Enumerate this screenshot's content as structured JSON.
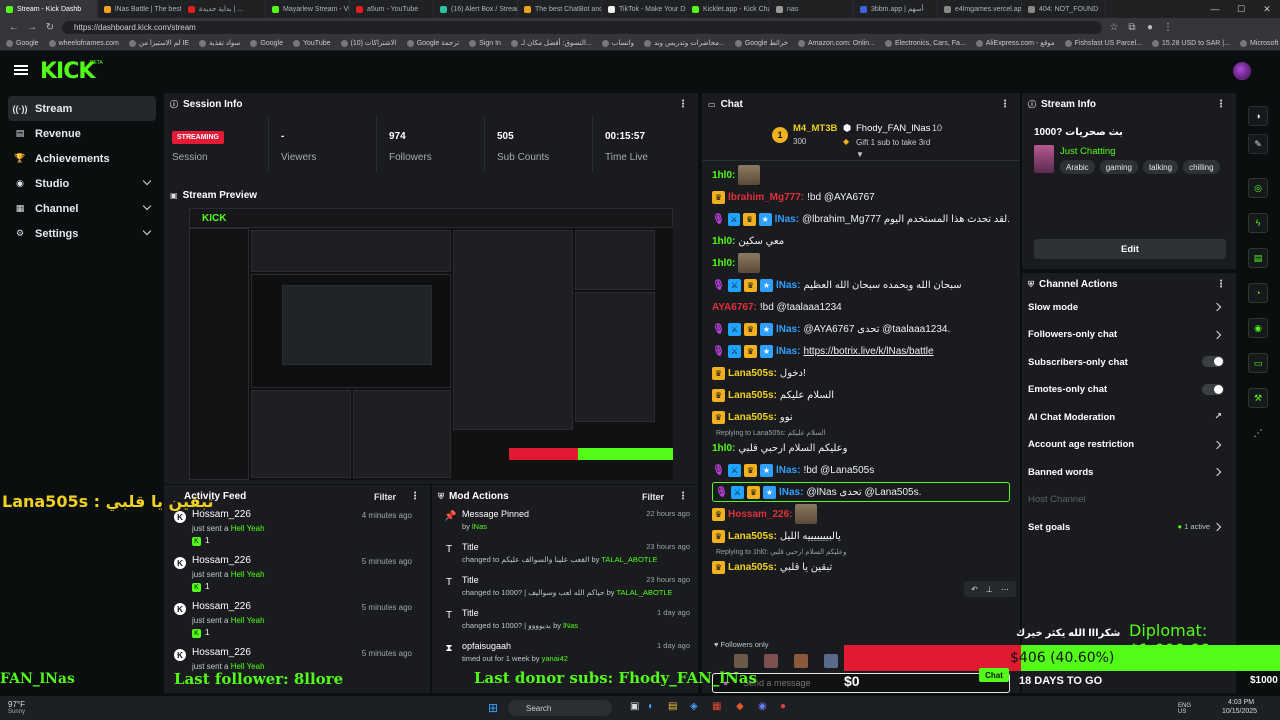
{
  "browser": {
    "tabs": [
      {
        "label": "Stream - Kick Dashb",
        "active": true,
        "color": "#53fc18"
      },
      {
        "label": "lNas Battle | The best",
        "active": false,
        "color": "#f0a020"
      },
      {
        "label": "بداية جديدة | ...",
        "active": false,
        "color": "#e02020"
      },
      {
        "label": "Mayarlew Stream - Vi",
        "active": false,
        "color": "#53fc18"
      },
      {
        "label": "a5um - YouTube",
        "active": false,
        "color": "#e02020"
      },
      {
        "label": "(16) Alert Box / Stream",
        "active": false,
        "color": "#30c0a0"
      },
      {
        "label": "The best ChatBot and",
        "active": false,
        "color": "#f0a020"
      },
      {
        "label": "TikTok - Make Your D",
        "active": false,
        "color": "#eeeeee"
      },
      {
        "label": "Kicklet.app - Kick Cha",
        "active": false,
        "color": "#53fc18"
      },
      {
        "label": "nas",
        "active": false,
        "color": "#999999"
      },
      {
        "label": "3bbm.app | أسهم",
        "active": false,
        "color": "#4060e0"
      },
      {
        "label": "e4lmgames.vercel.app",
        "active": false,
        "color": "#888888"
      },
      {
        "label": "404: NOT_FOUND",
        "active": false,
        "color": "#888888"
      }
    ],
    "url": "https://dashboard.kick.com/stream",
    "bookmarks": [
      "Google",
      "wheelofnames.com",
      "لم الاستيزا من IE",
      "سواد تقذية",
      "Google",
      "YouTube",
      "(10) الاشتراكات",
      "Google ترجمة",
      "Sign In",
      "التسوق: أفضل مكان لـ...",
      "واتساب",
      "محاضرات وتدريس وند...",
      "Google خرائط",
      "Amazon.com: Onlin...",
      "Electronics, Cars, Fa...",
      "AliExpress.com - موقع",
      "Fishsfast US Parcel...",
      "15.28 USD to SAR |...",
      "Microsoft Learning",
      "الطقس"
    ]
  },
  "header": {
    "logo": "KICK",
    "beta": "BETA"
  },
  "sidebar": {
    "items": [
      {
        "label": "Stream",
        "icon": "broadcast-icon",
        "glyph": "((·))",
        "active": true,
        "chevron": false
      },
      {
        "label": "Revenue",
        "icon": "revenue-icon",
        "glyph": "▤",
        "active": false,
        "chevron": false
      },
      {
        "label": "Achievements",
        "icon": "trophy-icon",
        "glyph": "🏆",
        "active": false,
        "chevron": false
      },
      {
        "label": "Studio",
        "icon": "studio-icon",
        "glyph": "◉",
        "active": false,
        "chevron": true
      },
      {
        "label": "Channel",
        "icon": "channel-icon",
        "glyph": "▦",
        "active": false,
        "chevron": true
      },
      {
        "label": "Settings",
        "icon": "gear-icon",
        "glyph": "⚙",
        "active": false,
        "chevron": true
      }
    ]
  },
  "session": {
    "title": "Session Info",
    "badge": "STREAMING",
    "badge_label": "Session",
    "stats": [
      {
        "value": "-",
        "label": "Viewers"
      },
      {
        "value": "974",
        "label": "Followers"
      },
      {
        "value": "505",
        "label": "Sub Counts"
      },
      {
        "value": "00:15:57",
        "label": "Time Live"
      }
    ]
  },
  "preview": {
    "title": "Stream Preview"
  },
  "activity": {
    "title": "Activity Feed",
    "filter": "Filter",
    "items": [
      {
        "name": "Hossam_226",
        "time": "4 minutes ago",
        "action": "just sent a",
        "gift": "Hell Yeah",
        "count": "1"
      },
      {
        "name": "Hossam_226",
        "time": "5 minutes ago",
        "action": "just sent a",
        "gift": "Hell Yeah",
        "count": "1"
      },
      {
        "name": "Hossam_226",
        "time": "5 minutes ago",
        "action": "just sent a",
        "gift": "Hell Yeah",
        "count": "1"
      },
      {
        "name": "Hossam_226",
        "time": "5 minutes ago",
        "action": "just sent a",
        "gift": "Hell Yeah",
        "count": ""
      }
    ]
  },
  "mod": {
    "title": "Mod Actions",
    "filter": "Filter",
    "items": [
      {
        "icon": "pin-icon",
        "glyph": "📌",
        "title": "Message Pinned",
        "pre": "by",
        "val": "lNas",
        "post": "",
        "time": "22 hours ago"
      },
      {
        "icon": "title-icon",
        "glyph": "T",
        "title": "Title",
        "pre": "changed to القعب علينا والسوالف عليكم",
        "val": "TALAL_ABOTLE",
        "post": "by",
        "time": "23 hours ago"
      },
      {
        "icon": "title-icon",
        "glyph": "T",
        "title": "Title",
        "pre": "changed to 1000? | حياكم الله لعب وسواليف",
        "val": "TALAL_ABOTLE",
        "post": "by",
        "time": "23 hours ago"
      },
      {
        "icon": "title-icon",
        "glyph": "T",
        "title": "Title",
        "pre": "changed to 1000? | بديوووو",
        "val": "lNas",
        "post": "by",
        "time": "1 day ago"
      },
      {
        "icon": "timeout-icon",
        "glyph": "⧗",
        "title": "opfaisugaah",
        "pre": "timed out for 1 week by",
        "val": "yanai42",
        "post": "",
        "time": "1 day ago"
      }
    ]
  },
  "chat": {
    "title": "Chat",
    "pinned_user": "M4_MT3B",
    "pinned_amount": "300",
    "gift_user": "Fhody_FAN_lNas",
    "gift_count": "10",
    "gift_note": "Gift 1 sub to take 3rd",
    "rank": "1",
    "lines": [
      {
        "user": "1hl0:",
        "color": "#53fc18",
        "text": "",
        "badges": [],
        "emote": true
      },
      {
        "user": "lbrahim_Mg777:",
        "color": "#e0303a",
        "text": "!bd @AYA6767",
        "badges": [
          "b-crown"
        ]
      },
      {
        "user": "lNas:",
        "color": "#30a0ff",
        "text": "@lbrahim_Mg777 لقد تحدث هذا المستخدم اليوم.",
        "badges": [
          "b-mic",
          "b-mod",
          "b-crown",
          "b-sub"
        ]
      },
      {
        "user": "1hl0:",
        "color": "#53fc18",
        "text": "معي سكين",
        "badges": []
      },
      {
        "user": "1hl0:",
        "color": "#53fc18",
        "text": "",
        "badges": [],
        "emote": true
      },
      {
        "user": "lNas:",
        "color": "#30a0ff",
        "text": "سبحان الله وبحمده سبحان الله العظيم",
        "badges": [
          "b-mic",
          "b-mod",
          "b-crown",
          "b-sub"
        ]
      },
      {
        "user": "AYA6767:",
        "color": "#e0303a",
        "text": "!bd @taalaaa1234",
        "badges": []
      },
      {
        "user": "lNas:",
        "color": "#30a0ff",
        "text": "@AYA6767 تحدى @taalaaa1234.",
        "badges": [
          "b-mic",
          "b-mod",
          "b-crown",
          "b-sub"
        ]
      },
      {
        "user": "lNas:",
        "color": "#30a0ff",
        "text": "https://botrix.live/k/lNas/battle",
        "badges": [
          "b-mic",
          "b-mod",
          "b-crown",
          "b-sub"
        ]
      },
      {
        "user": "Lana505s:",
        "color": "#f0d020",
        "text": "دخول!",
        "badges": [
          "b-crown"
        ]
      },
      {
        "user": "Lana505s:",
        "color": "#f0d020",
        "text": "السلام عليكم",
        "badges": [
          "b-crown"
        ]
      },
      {
        "user": "Lana505s:",
        "color": "#f0d020",
        "text": "نوو",
        "badges": [
          "b-crown"
        ]
      },
      {
        "user": "1hl0:",
        "color": "#53fc18",
        "text": "وعليكم السلام ارحبي قلبي",
        "badges": [],
        "reply": "Replying to Lana505s: السلام عليكم"
      },
      {
        "user": "lNas:",
        "color": "#30a0ff",
        "text": "!bd @Lana505s",
        "badges": [
          "b-mic",
          "b-mod",
          "b-crown",
          "b-sub"
        ]
      },
      {
        "user": "lNas:",
        "color": "#30a0ff",
        "text": "@lNas تحدى @Lana505s.",
        "badges": [
          "b-mic",
          "b-mod",
          "b-crown",
          "b-sub"
        ],
        "highlight": true
      },
      {
        "user": "Hossam_226:",
        "color": "#e0303a",
        "text": "",
        "badges": [
          "b-crown"
        ],
        "emote": true
      },
      {
        "user": "Lana505s:",
        "color": "#f0d020",
        "text": "يالبيييييييه الليل",
        "badges": [
          "b-crown"
        ]
      },
      {
        "user": "Lana505s:",
        "color": "#f0d020",
        "text": "تبقين يا قلبي",
        "badges": [
          "b-crown"
        ],
        "reply": "Replying to 1hl0: وعليكم السلام ارحبي قلبي"
      }
    ],
    "followers_only": "Followers only",
    "placeholder": "Send a message",
    "send_label": "Chat"
  },
  "stream_info": {
    "title": "Stream Info",
    "stream_title": "1000? بث صحريات",
    "category": "Just Chatting",
    "tags": [
      "Arabic",
      "gaming",
      "talking",
      "chilling"
    ],
    "edit": "Edit"
  },
  "channel_actions": {
    "title": "Channel Actions",
    "items": [
      {
        "label": "Slow mode",
        "kind": "chevron"
      },
      {
        "label": "Followers-only chat",
        "kind": "chevron"
      },
      {
        "label": "Subscribers-only chat",
        "kind": "toggle"
      },
      {
        "label": "Emotes-only chat",
        "kind": "toggle"
      },
      {
        "label": "AI Chat Moderation",
        "kind": "external"
      },
      {
        "label": "Account age restriction",
        "kind": "chevron"
      },
      {
        "label": "Banned words",
        "kind": "chevron"
      },
      {
        "label": "Host Channel",
        "kind": "disabled"
      },
      {
        "label": "Set goals",
        "kind": "goal",
        "extra": "1 active"
      }
    ]
  },
  "overlay": {
    "chat_name": "Lana505s :",
    "chat_msg": "تبقين يا قلبي",
    "fan": "FAN_lNas",
    "last_follower": "Last follower: 8llore",
    "last_donor": "Last donor subs: Fhody_FAN_lNas",
    "diplomat": "Diplomat: $1,000.00",
    "thanks": "شكرااا الله يكثر خيرك",
    "progress_text": "$406 (40.60%)",
    "progress": 0.406,
    "zero": "$0",
    "days": "18 DAYS TO GO",
    "goal_end": "$1000"
  },
  "taskbar": {
    "weather": "97°F",
    "weather_sub": "Sunny",
    "search": "Search",
    "lang": "ENG US",
    "time": "4:03 PM",
    "date": "10/15/2025"
  }
}
